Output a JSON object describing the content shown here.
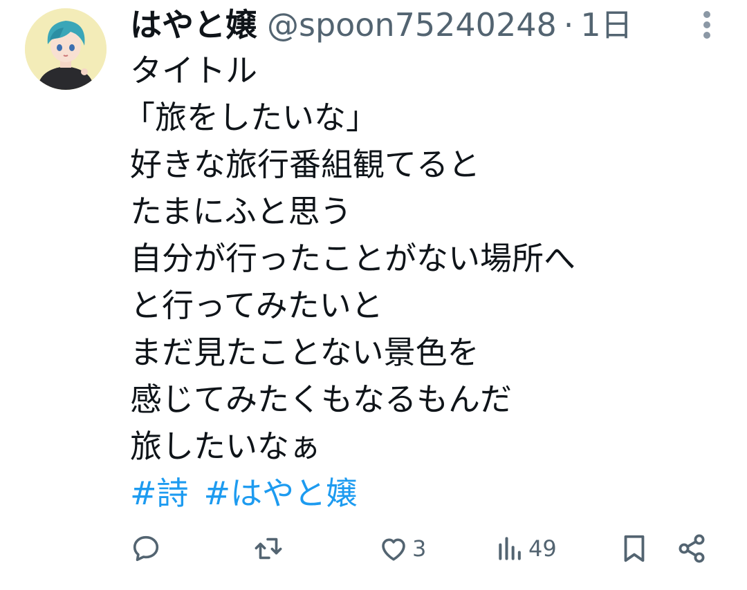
{
  "tweet": {
    "display_name": "はやと嬢",
    "handle": "@spoon75240248",
    "separator": "·",
    "time": "1日",
    "lines": [
      "タイトル",
      "「旅をしたいな」",
      "好きな旅行番組観てると",
      "たまにふと思う",
      "自分が行ったことがない場所へ",
      "と行ってみたいと",
      "まだ見たことない景色を",
      "感じてみたくもなるもんだ",
      "旅したいなぁ"
    ],
    "hashtags": [
      "#詩",
      "#はやと嬢"
    ]
  },
  "actions": {
    "reply_icon": "reply-icon",
    "retweet_icon": "retweet-icon",
    "like_icon": "heart-icon",
    "like_count": "3",
    "views_icon": "views-icon",
    "views_count": "49",
    "bookmark_icon": "bookmark-icon",
    "share_icon": "share-icon"
  },
  "colors": {
    "text": "#0f1419",
    "secondary": "#536471",
    "hashtag": "#1d9bf0"
  }
}
